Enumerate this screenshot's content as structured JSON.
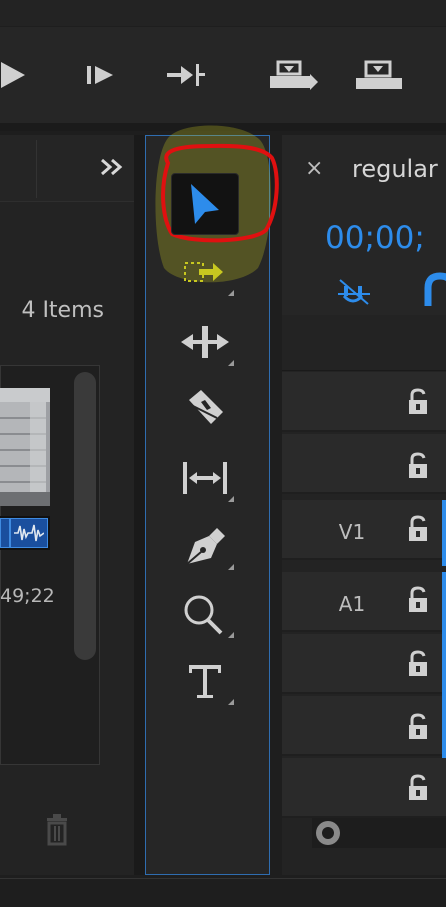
{
  "project_panel": {
    "item_count": "4 Items",
    "clip_timecode": "49;22"
  },
  "timeline": {
    "sequence_name": "regular",
    "close_label": "×",
    "timecode": "00;00;",
    "tracks": [
      "",
      "",
      "V1",
      "A1",
      "",
      "",
      ""
    ]
  },
  "tools": [
    {
      "name": "selection-tool",
      "active": true
    },
    {
      "name": "track-select-tool"
    },
    {
      "name": "ripple-edit-tool"
    },
    {
      "name": "razor-tool"
    },
    {
      "name": "slip-tool"
    },
    {
      "name": "pen-tool"
    },
    {
      "name": "zoom-tool"
    },
    {
      "name": "type-tool"
    }
  ],
  "colors": {
    "accent": "#2d8ceb",
    "annotation": "#e01010",
    "highlight": "#c8c820",
    "panel_border": "#2f6db0"
  }
}
